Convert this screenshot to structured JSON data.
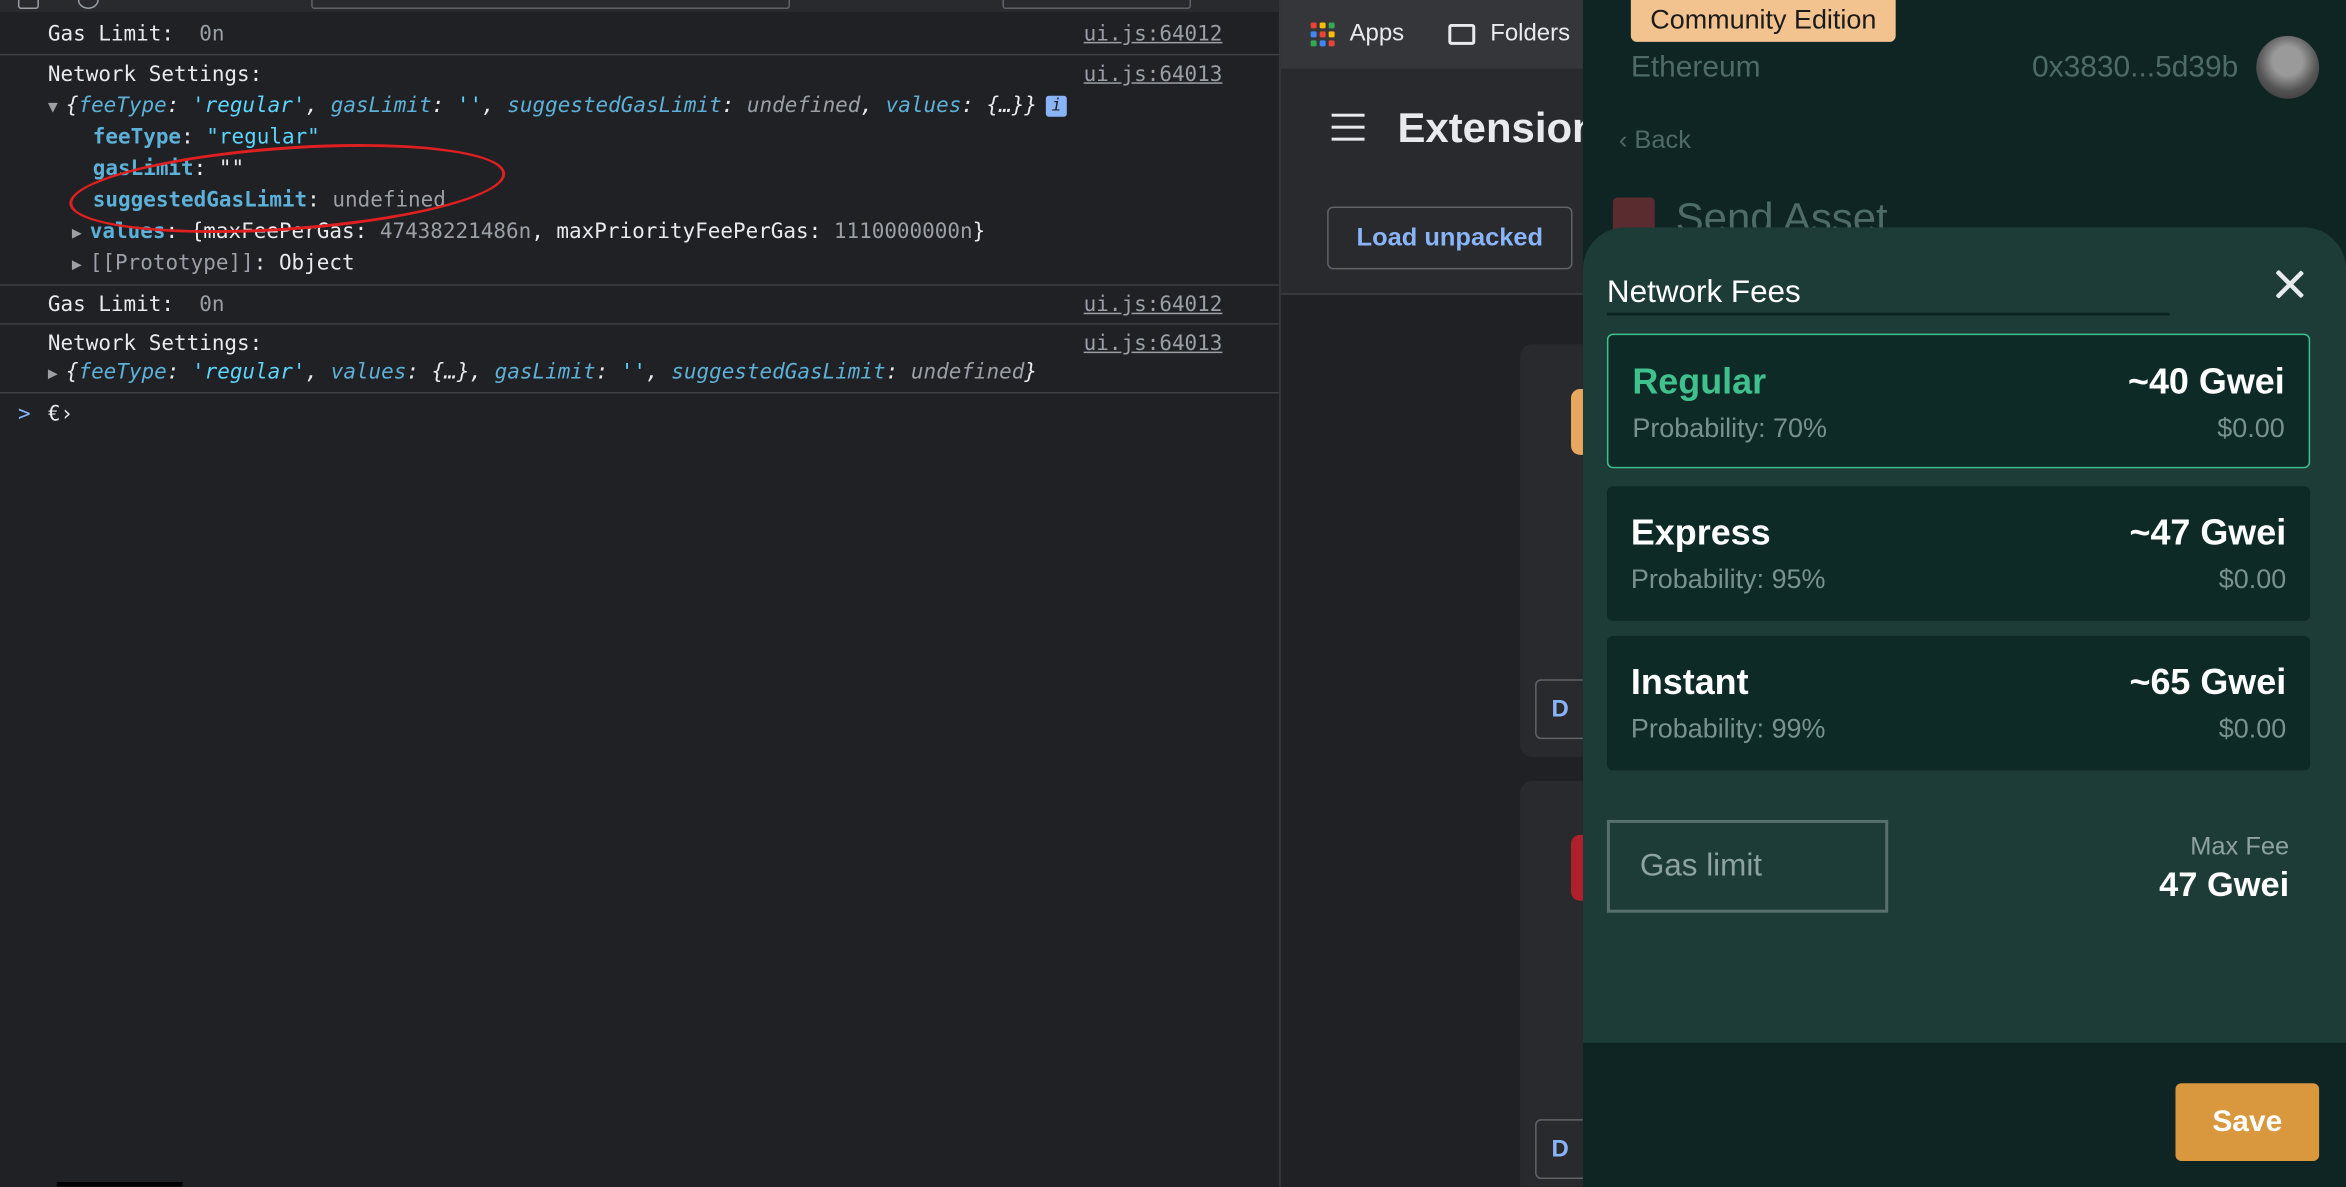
{
  "console": {
    "messages": [
      {
        "text": "Gas Limit:",
        "value": "0n",
        "source": "ui.js:64012"
      },
      {
        "text": "Network Settings:",
        "source": "ui.js:64013",
        "summary": {
          "open": "{",
          "k1": "feeType",
          "v1": "'regular'",
          "k2": "gasLimit",
          "v2": "''",
          "k3": "suggestedGasLimit",
          "v3": "undefined",
          "k4": "values",
          "v4": "{…}",
          "close": "}"
        },
        "props": [
          {
            "key": "feeType",
            "value": "\"regular\""
          },
          {
            "key": "gasLimit",
            "value": "\"\""
          },
          {
            "key": "suggestedGasLimit",
            "value": "undefined"
          }
        ],
        "values_row": {
          "key": "values",
          "text": "{maxFeePerGas: ",
          "mfpg": "47438221486n",
          "mid": ", maxPriorityFeePerGas: ",
          "mpfpg": "1110000000n",
          "end": "}"
        },
        "proto_row": {
          "key": "[[Prototype]]",
          "value": "Object"
        }
      },
      {
        "text": "Gas Limit:",
        "value": "0n",
        "source": "ui.js:64012"
      },
      {
        "text": "Network Settings:",
        "source": "ui.js:64013",
        "summary": {
          "open": "{",
          "k1": "feeType",
          "v1": "'regular'",
          "k2": "values",
          "v2": "{…}",
          "k3": "gasLimit",
          "v3": "''",
          "k4": "suggestedGasLimit",
          "v4": "undefined",
          "close": "}"
        }
      }
    ],
    "prompt_symbol": ">",
    "prompt_text": "€›",
    "info_badge": "i"
  },
  "chrome": {
    "bookmarks": [
      {
        "label": "Apps",
        "icon": "apps-grid-icon"
      },
      {
        "label": "Folders",
        "icon": "folder-icon"
      }
    ],
    "page_title": "Extensions",
    "load_unpacked": "Load unpacked",
    "card_button_letter": "D"
  },
  "wallet": {
    "badge": "Community Edition",
    "network": "Ethereum",
    "address": "0x3830...5d39b",
    "back_label": "Back",
    "send_title": "Send Asset",
    "sheet_title": "Network Fees",
    "fees": [
      {
        "name": "Regular",
        "probability": "Probability: 70%",
        "gwei": "~40 Gwei",
        "usd": "$0.00",
        "selected": true
      },
      {
        "name": "Express",
        "probability": "Probability: 95%",
        "gwei": "~47 Gwei",
        "usd": "$0.00",
        "selected": false
      },
      {
        "name": "Instant",
        "probability": "Probability: 99%",
        "gwei": "~65 Gwei",
        "usd": "$0.00",
        "selected": false
      }
    ],
    "gas_limit_placeholder": "Gas limit",
    "gas_limit_value": "",
    "max_fee_label": "Max Fee",
    "max_fee_value": "47 Gwei",
    "save_label": "Save"
  },
  "colors": {
    "accent_green": "#3fc18d",
    "save_orange": "#d9983e",
    "badge_peach": "#f2c28f",
    "annotation_red": "#e02020"
  }
}
